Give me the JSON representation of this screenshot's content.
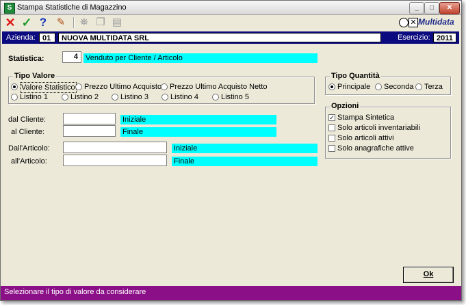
{
  "window": {
    "title": "Stampa Statistiche di Magazzino",
    "app_icon": "S",
    "min": "_",
    "max": "□",
    "close": "✕"
  },
  "toolbar": {
    "icons": {
      "cancel": "✕",
      "confirm": "✓",
      "help": "?",
      "edit": "✎",
      "binoculars": "⛯",
      "copy": "❐",
      "print": "▤"
    },
    "logo_text": "Multidata",
    "logo_box": "✕"
  },
  "colors": {
    "accent_bar": "#0b0a7e",
    "highlight": "#00ffff",
    "status_bar": "#8b1087"
  },
  "header": {
    "azienda_label": "Azienda:",
    "azienda_code": "01",
    "azienda_name": "NUOVA MULTIDATA SRL",
    "esercizio_label": "Esercizio:",
    "esercizio_value": "2011"
  },
  "statistica": {
    "label": "Statistica:",
    "code": "4",
    "description": "Venduto per Cliente / Articolo"
  },
  "tipo_valore": {
    "title": "Tipo Valore",
    "options": [
      "Valore Statistico",
      "Prezzo Ultimo Acquisto",
      "Prezzo Ultimo Acquisto Netto",
      "Listino 1",
      "Listino 2",
      "Listino 3",
      "Listino 4",
      "Listino 5"
    ],
    "selected": "Valore Statistico"
  },
  "tipo_quantita": {
    "title": "Tipo Quantità",
    "options": [
      "Principale",
      "Seconda",
      "Terza"
    ],
    "selected": "Principale"
  },
  "opzioni": {
    "title": "Opzioni",
    "items": [
      {
        "label": "Stampa Sintetica",
        "checked": true
      },
      {
        "label": "Solo articoli inventariabili",
        "checked": false
      },
      {
        "label": "Solo articoli attivi",
        "checked": false
      },
      {
        "label": "Solo anagrafiche attive",
        "checked": false
      }
    ]
  },
  "ranges": {
    "dal_cliente_label": "dal Cliente:",
    "al_cliente_label": "al Cliente:",
    "dal_articolo_label": "Dall'Articolo:",
    "al_articolo_label": "all'Articolo:",
    "dal_cliente_value": "",
    "al_cliente_value": "",
    "dal_articolo_value": "",
    "al_articolo_value": "",
    "initial": "Iniziale",
    "final": "Finale"
  },
  "ok_label": "Ok",
  "status_text": "Selezionare il tipo di valore da considerare"
}
